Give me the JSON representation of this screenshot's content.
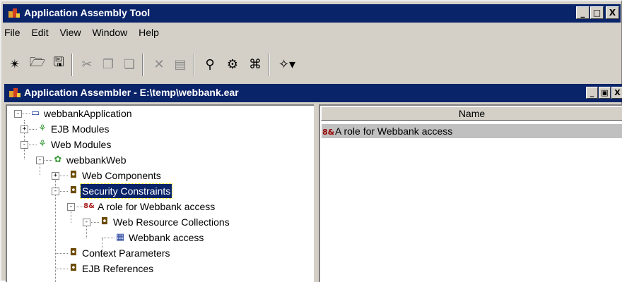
{
  "window": {
    "title": "Application Assembly Tool",
    "controls": [
      "_",
      "□",
      "X"
    ]
  },
  "menu": [
    "File",
    "Edit",
    "View",
    "Window",
    "Help"
  ],
  "toolbar": [
    "new-icon",
    "open-icon",
    "save-icon",
    "cut-icon",
    "copy-icon",
    "paste-icon",
    "delete-icon",
    "properties-icon",
    "search-icon",
    "verify-icon",
    "generate-icon",
    "wizard-icon"
  ],
  "inner": {
    "title": "Application Assembler - E:\\temp\\webbank.ear",
    "controls": [
      "_",
      "▣",
      "X"
    ]
  },
  "tree": [
    {
      "label": "webbankApplication",
      "toggle": "-"
    },
    {
      "label": "EJB Modules",
      "toggle": "+"
    },
    {
      "label": "Web Modules",
      "toggle": "-"
    },
    {
      "label": "webbankWeb",
      "toggle": "-"
    },
    {
      "label": "Web Components",
      "toggle": "+"
    },
    {
      "label": "Security Constraints",
      "toggle": "-",
      "selected": true
    },
    {
      "label": "A role for Webbank access",
      "toggle": "-"
    },
    {
      "label": "Web Resource Collections",
      "toggle": "-"
    },
    {
      "label": "Webbank access",
      "toggle": ""
    },
    {
      "label": "Context Parameters",
      "toggle": ""
    },
    {
      "label": "EJB References",
      "toggle": ""
    }
  ],
  "list": {
    "column": "Name",
    "rows": [
      "A role for Webbank access"
    ]
  }
}
